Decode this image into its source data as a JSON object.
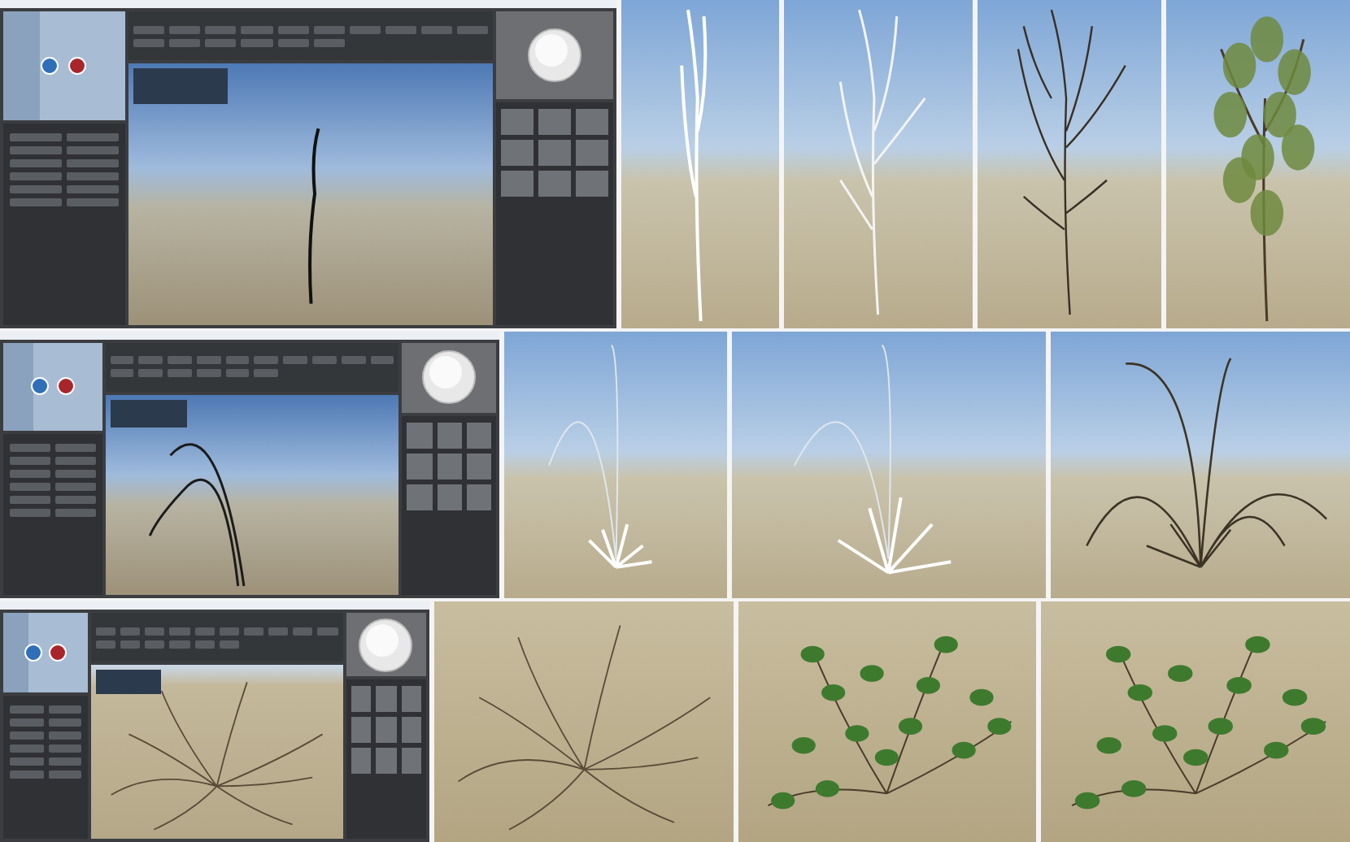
{
  "rows": [
    {
      "panels": [
        {
          "kind": "app",
          "subject": {
            "kind": "stem"
          }
        },
        {
          "kind": "render",
          "subject": {
            "kind": "trunk"
          }
        },
        {
          "kind": "render",
          "subject": {
            "kind": "branches"
          }
        },
        {
          "kind": "render",
          "subject": {
            "kind": "twigtree"
          }
        },
        {
          "kind": "render",
          "subject": {
            "kind": "leafytree"
          }
        }
      ]
    },
    {
      "panels": [
        {
          "kind": "app",
          "subject": {
            "kind": "blades"
          }
        },
        {
          "kind": "render",
          "subject": {
            "kind": "tuft"
          }
        },
        {
          "kind": "render",
          "subject": {
            "kind": "bigtuft"
          }
        },
        {
          "kind": "render",
          "subject": {
            "kind": "seedgrass"
          }
        }
      ]
    },
    {
      "panels": [
        {
          "kind": "app",
          "subject": {
            "kind": "twigshrub"
          }
        },
        {
          "kind": "render",
          "subject": {
            "kind": "twigshrub"
          }
        },
        {
          "kind": "render",
          "subject": {
            "kind": "leafyshrub"
          }
        },
        {
          "kind": "render",
          "subject": {
            "kind": "leafyshrub"
          }
        }
      ]
    }
  ]
}
